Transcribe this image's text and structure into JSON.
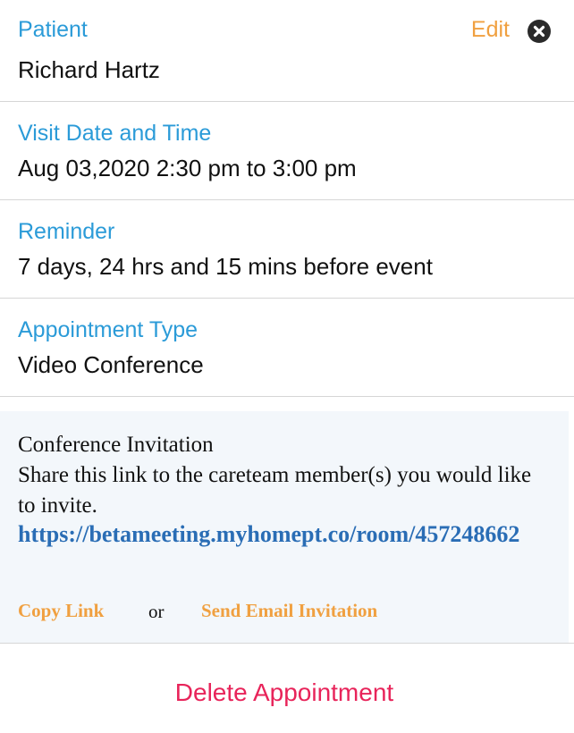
{
  "patient": {
    "label": "Patient",
    "value": "Richard Hartz",
    "edit_label": "Edit"
  },
  "visit": {
    "label": "Visit Date and Time",
    "value": "Aug 03,2020 2:30 pm to 3:00 pm"
  },
  "reminder": {
    "label": "Reminder",
    "value": "7 days, 24 hrs and 15 mins before event"
  },
  "appointment_type": {
    "label": "Appointment Type",
    "value": "Video Conference"
  },
  "invitation": {
    "title": "Conference Invitation",
    "text": "Share this link to the careteam member(s) you would like to invite.",
    "link": "https://betameeting.myhomept.co/room/457248662",
    "copy_link_label": "Copy Link",
    "or_label": "or",
    "send_email_label": "Send Email Invitation"
  },
  "delete_label": "Delete Appointment",
  "icons": {
    "close": "close-circle-icon"
  },
  "colors": {
    "label_blue": "#2b9bd8",
    "link_blue": "#2a6db5",
    "accent_orange": "#f0a040",
    "delete_red": "#e8245a"
  }
}
